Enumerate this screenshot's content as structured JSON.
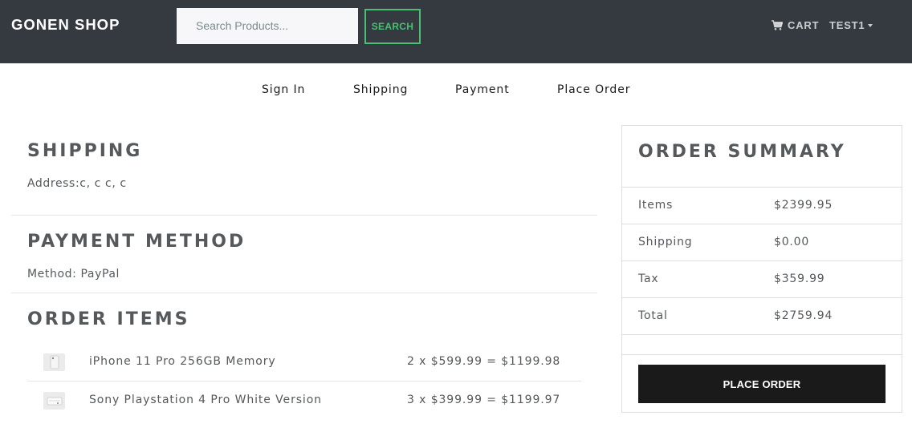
{
  "header": {
    "brand": "GONEN SHOP",
    "search_placeholder": "Search Products...",
    "search_button": "SEARCH",
    "cart_label": "CART",
    "cart_icon": "shopping-cart-icon",
    "user_label": "TEST1",
    "accent_color": "#4bbf73",
    "bg_color": "#343a40"
  },
  "steps": [
    {
      "label": "Sign In"
    },
    {
      "label": "Shipping"
    },
    {
      "label": "Payment"
    },
    {
      "label": "Place Order"
    }
  ],
  "shipping": {
    "title": "SHIPPING",
    "address": "Address:c, c c, c"
  },
  "payment": {
    "title": "PAYMENT METHOD",
    "method": "Method: PayPal"
  },
  "order_items": {
    "title": "ORDER ITEMS",
    "items": [
      {
        "name": "iPhone 11 Pro 256GB Memory",
        "calc": "2 x $599.99 = $1199.98"
      },
      {
        "name": "Sony Playstation 4 Pro White Version",
        "calc": "3 x $399.99 = $1199.97"
      }
    ]
  },
  "summary": {
    "title": "ORDER SUMMARY",
    "rows": [
      {
        "label": "Items",
        "value": "$2399.95"
      },
      {
        "label": "Shipping",
        "value": "$0.00"
      },
      {
        "label": "Tax",
        "value": "$359.99"
      },
      {
        "label": "Total",
        "value": "$2759.94"
      }
    ],
    "button": "PLACE ORDER"
  }
}
